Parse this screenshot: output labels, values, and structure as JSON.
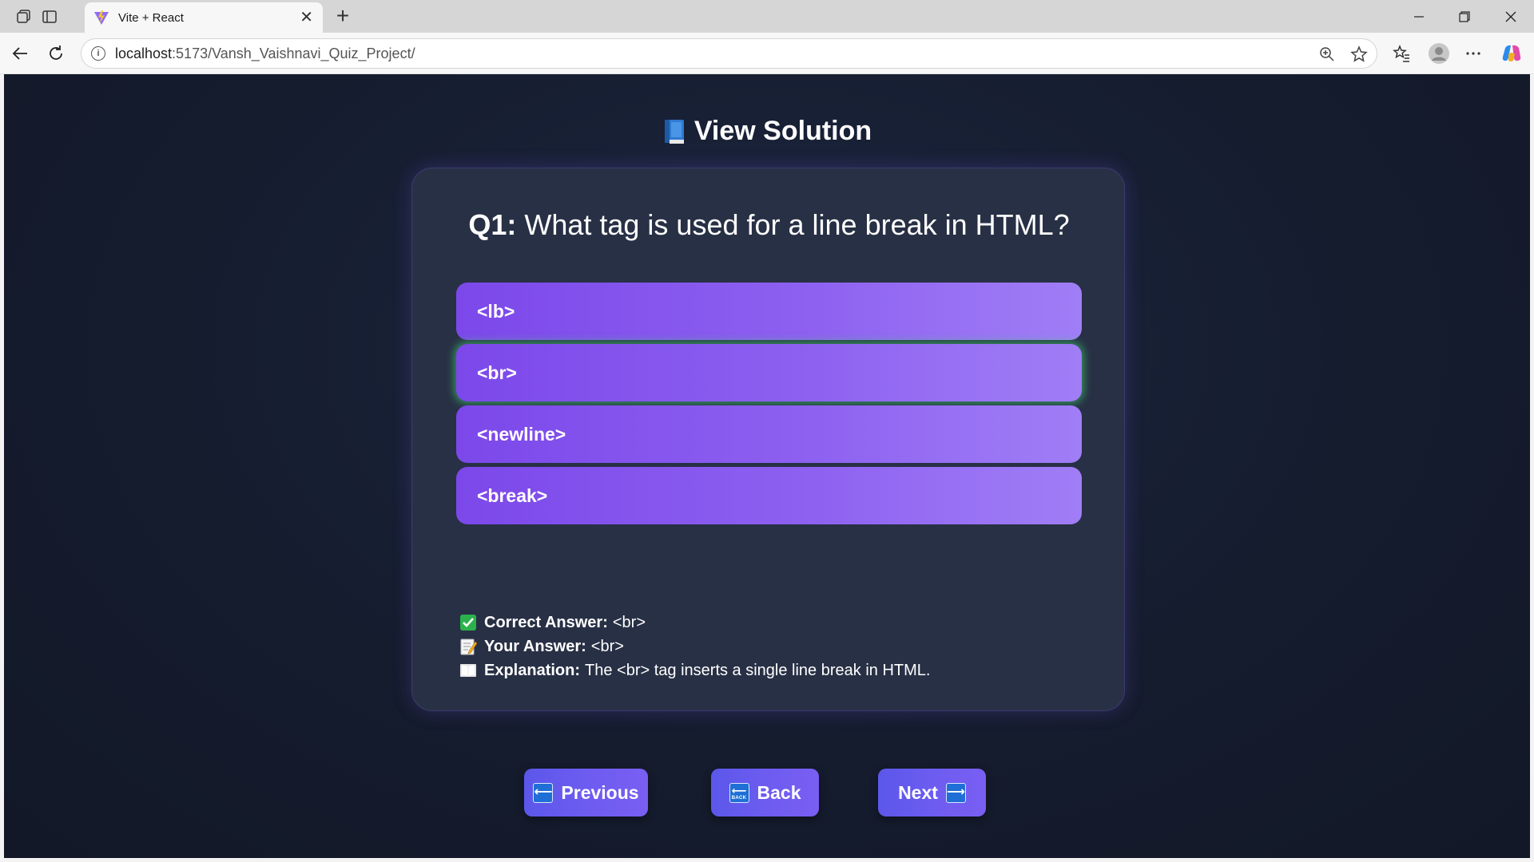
{
  "browser": {
    "tab_title": "Vite + React",
    "url_host": "localhost",
    "url_rest": ":5173/Vansh_Vaishnavi_Quiz_Project/"
  },
  "page": {
    "title": "View Solution",
    "title_icon": "blue-book-icon"
  },
  "question": {
    "number_label": "Q1:",
    "text": "What tag is used for a line break in HTML?"
  },
  "options": [
    {
      "label": "<lb>",
      "correct": false
    },
    {
      "label": "<br>",
      "correct": true
    },
    {
      "label": "<newline>",
      "correct": false
    },
    {
      "label": "<break>",
      "correct": false
    }
  ],
  "solution": {
    "correct_label": "Correct Answer:",
    "correct_value": "<br>",
    "your_label": "Your Answer:",
    "your_value": "<br>",
    "explanation_label": "Explanation:",
    "explanation_value": "The <br> tag inserts a single line break in HTML."
  },
  "buttons": {
    "previous": "Previous",
    "back": "Back",
    "next": "Next",
    "back_badge": "BACK"
  },
  "colors": {
    "background": "#151c2e",
    "card": "#283045",
    "option_gradient_start": "#7c48ea",
    "option_gradient_end": "#a07ef6",
    "button": "#6d5cf0",
    "correct_glow": "#3cdc6e"
  }
}
